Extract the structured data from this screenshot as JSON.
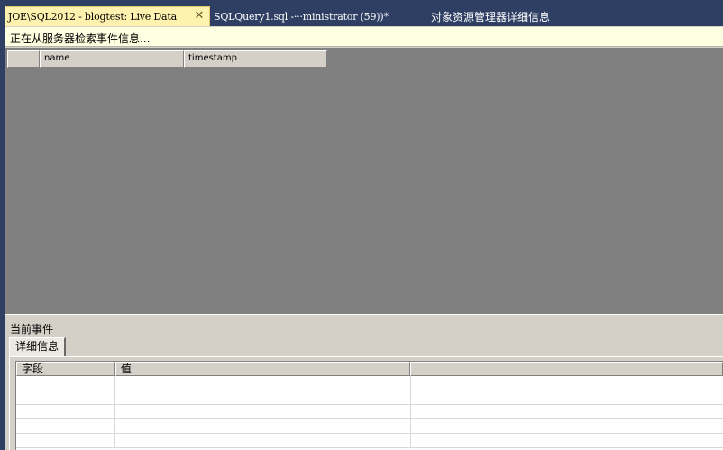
{
  "tabs": [
    {
      "label": "JOE\\SQL2012 - blogtest: Live Data",
      "active": true
    },
    {
      "label": "SQLQuery1.sql -···ministrator (59))*",
      "active": false
    },
    {
      "label": "对象资源管理器详细信息",
      "active": false
    }
  ],
  "icons": {
    "close": "close-icon"
  },
  "status": {
    "text": "正在从服务器检索事件信息..."
  },
  "events_grid": {
    "columns": [
      "name",
      "timestamp"
    ]
  },
  "current_event": {
    "title": "当前事件",
    "tabs": [
      "详细信息"
    ],
    "grid": {
      "columns": [
        "字段",
        "值"
      ]
    }
  },
  "colors": {
    "title_bar": "#2f3f63",
    "active_tab": "#fff2ae",
    "grid_background": "#808080",
    "panel": "#d4d0c8",
    "status_bar": "#ffffe1"
  }
}
